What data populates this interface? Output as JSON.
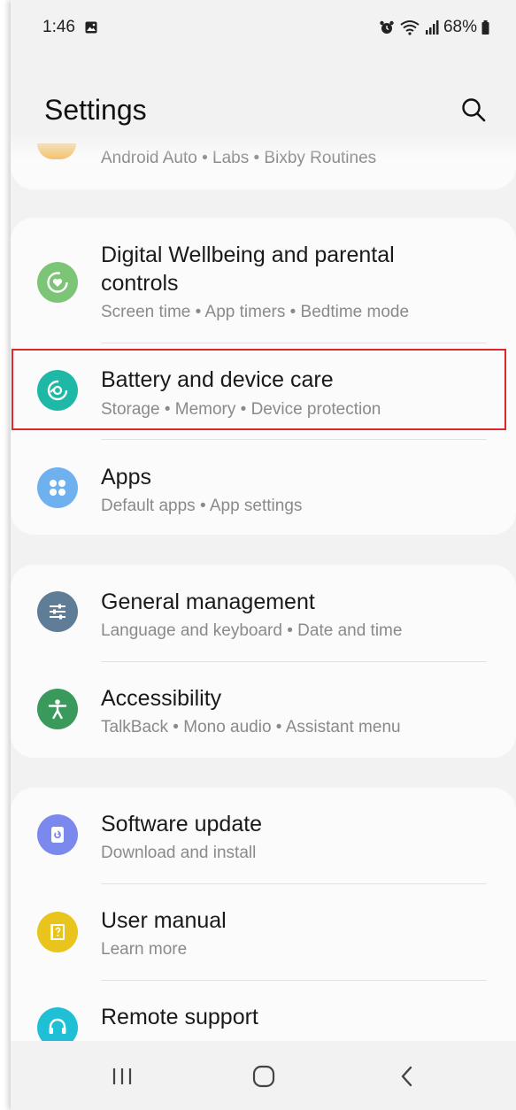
{
  "status_bar": {
    "time": "1:46",
    "battery": "68%"
  },
  "header": {
    "title": "Settings"
  },
  "partial_item": {
    "subtitle": "Android Auto  •  Labs  •  Bixby Routines"
  },
  "items": [
    {
      "title": "Digital Wellbeing and parental controls",
      "subtitle": "Screen time  •  App timers  •  Bedtime mode",
      "icon": "digital-wellbeing-icon",
      "color": "#7cc576"
    },
    {
      "title": "Battery and device care",
      "subtitle": "Storage  •  Memory  •  Device protection",
      "icon": "device-care-icon",
      "color": "#1fb8a6"
    },
    {
      "title": "Apps",
      "subtitle": "Default apps  •  App settings",
      "icon": "apps-icon",
      "color": "#6fb1ee"
    },
    {
      "title": "General management",
      "subtitle": "Language and keyboard  •  Date and time",
      "icon": "sliders-icon",
      "color": "#5f7d96"
    },
    {
      "title": "Accessibility",
      "subtitle": "TalkBack  •  Mono audio  •  Assistant menu",
      "icon": "accessibility-icon",
      "color": "#3a9a5c"
    },
    {
      "title": "Software update",
      "subtitle": "Download and install",
      "icon": "software-update-icon",
      "color": "#7b88ee"
    },
    {
      "title": "User manual",
      "subtitle": "Learn more",
      "icon": "user-manual-icon",
      "color": "#e8c41d"
    },
    {
      "title": "Remote support",
      "subtitle": "",
      "icon": "headset-icon",
      "color": "#1fbfd6"
    }
  ],
  "navbar": {
    "recents": "recents-icon",
    "home": "home-icon",
    "back": "back-icon"
  }
}
